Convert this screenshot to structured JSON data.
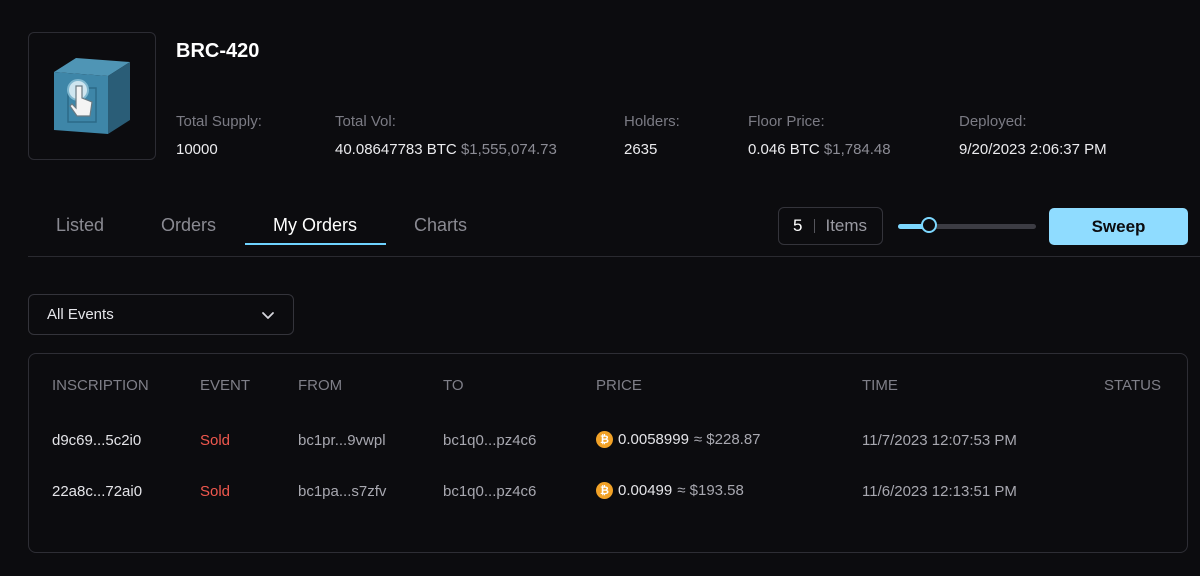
{
  "collection": {
    "name": "BRC-420",
    "thumbnail_icon": "tap-cube-icon",
    "stats": [
      {
        "label": "Total Supply:",
        "value": "10000",
        "extra": ""
      },
      {
        "label": "Total Vol:",
        "value": "40.08647783 BTC",
        "extra": "$1,555,074.73"
      },
      {
        "label": "Holders:",
        "value": "2635",
        "extra": ""
      },
      {
        "label": "Floor Price:",
        "value": "0.046 BTC",
        "extra": "$1,784.48"
      },
      {
        "label": "Deployed:",
        "value": "9/20/2023 2:06:37 PM",
        "extra": ""
      }
    ]
  },
  "tabs": [
    {
      "label": "Listed",
      "active": false
    },
    {
      "label": "Orders",
      "active": false
    },
    {
      "label": "My Orders",
      "active": true
    },
    {
      "label": "Charts",
      "active": false
    }
  ],
  "sweep_controls": {
    "items_count": "5",
    "items_label": "Items",
    "slider_level": 0.25,
    "sweep_label": "Sweep"
  },
  "filter": {
    "selected": "All Events",
    "icon": "chevron-down-icon"
  },
  "table": {
    "columns": [
      "INSCRIPTION",
      "EVENT",
      "FROM",
      "TO",
      "PRICE",
      "TIME",
      "STATUS"
    ],
    "rows": [
      {
        "inscription": "d9c69...5c2i0",
        "event": "Sold",
        "from": "bc1pr...9vwpl",
        "to": "bc1q0...pz4c6",
        "price_btc": "0.0058999",
        "price_usd": "≈ $228.87",
        "time": "11/7/2023 12:07:53 PM",
        "status": ""
      },
      {
        "inscription": "22a8c...72ai0",
        "event": "Sold",
        "from": "bc1pa...s7zfv",
        "to": "bc1q0...pz4c6",
        "price_btc": "0.00499",
        "price_usd": "≈ $193.58",
        "time": "11/6/2023 12:13:51 PM",
        "status": ""
      }
    ]
  },
  "colors": {
    "background": "#0c0c0f",
    "accent": "#8fdcff",
    "sold": "#f0584e",
    "btc": "#f2a227"
  }
}
